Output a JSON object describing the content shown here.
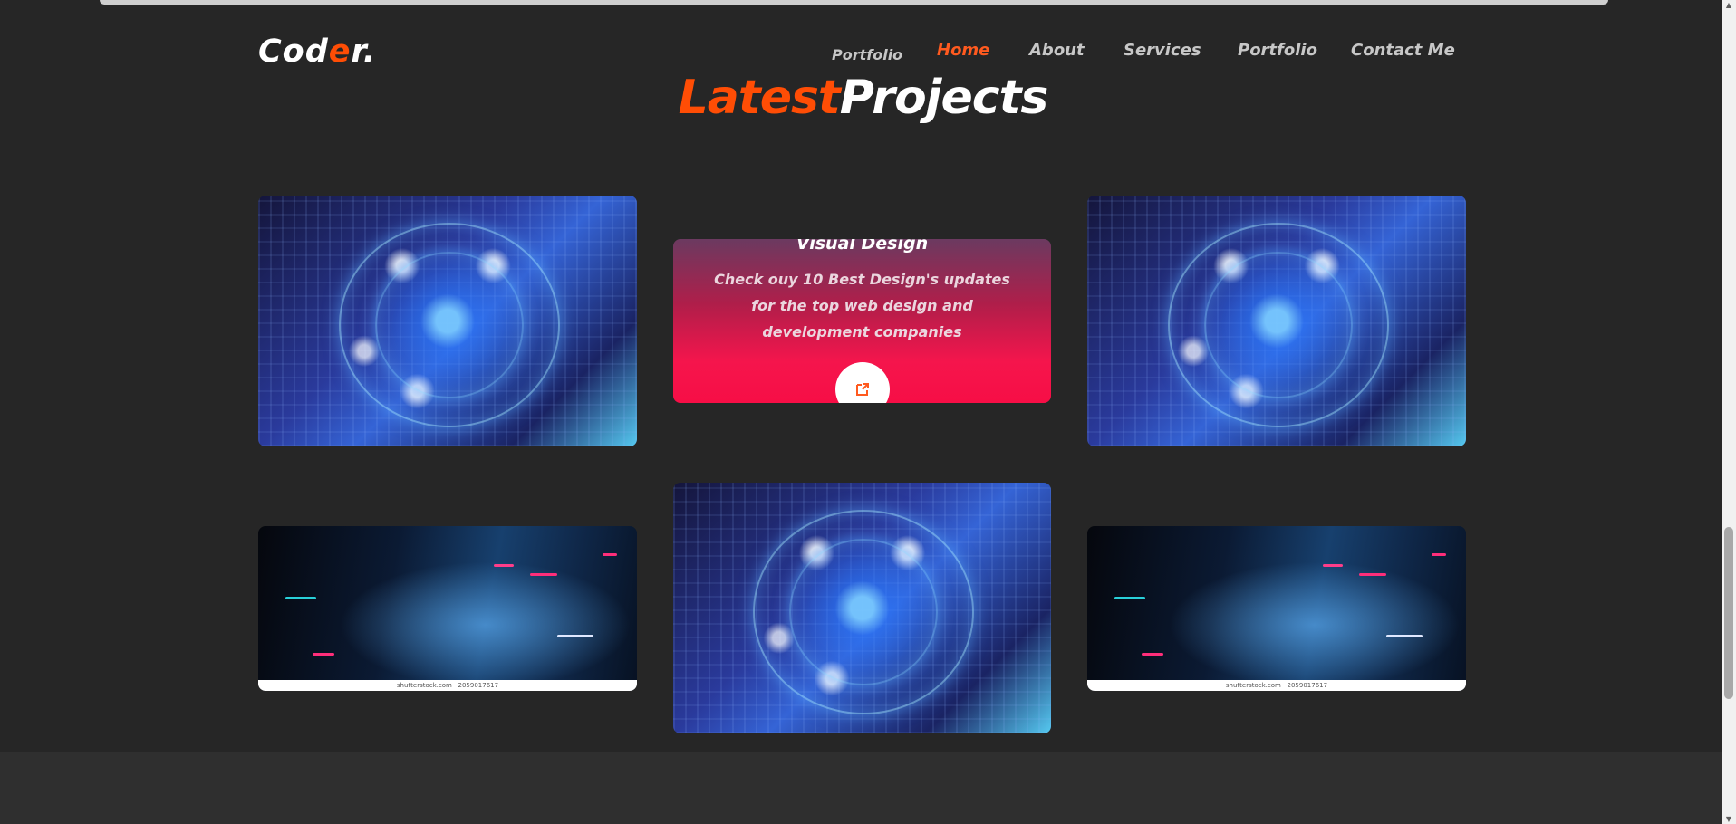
{
  "brand": {
    "prefix": "Cod",
    "accent": "e",
    "suffix": "r."
  },
  "nav": {
    "extra": "Portfolio",
    "home": "Home",
    "about": "About",
    "services": "Services",
    "portfolio": "Portfolio",
    "contact": "Contact Me"
  },
  "heading": {
    "accent": "Latest",
    "main": "Projects"
  },
  "overlay_card": {
    "title": "Visual Design",
    "text": "Check ouy 10 Best Design's updates for the top web design and development companies"
  },
  "image_caption": "shutterstock.com · 2059017617",
  "colors": {
    "accent": "#ff4d05",
    "background": "#262626",
    "overlay": "#f70e46"
  }
}
